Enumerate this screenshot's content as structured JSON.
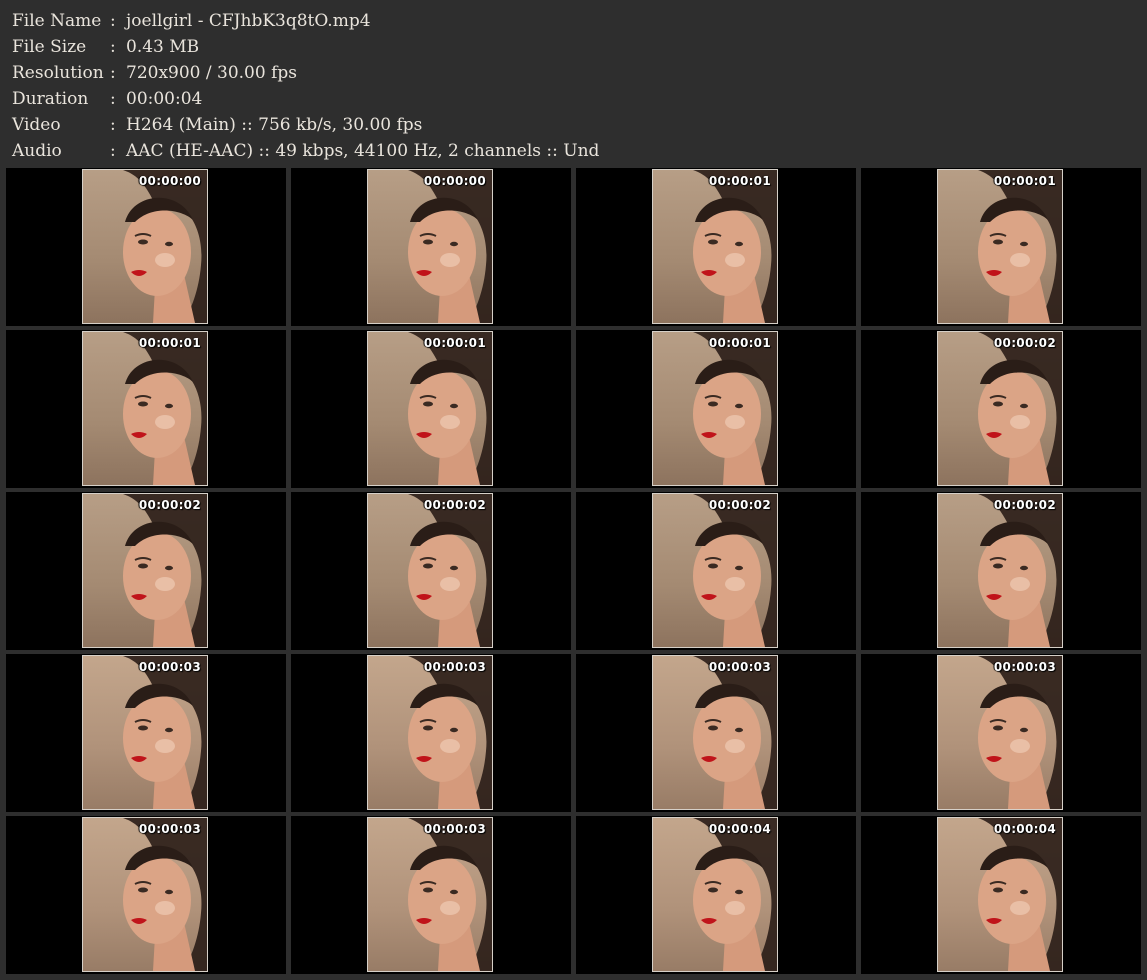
{
  "info": [
    {
      "key": "File Name",
      "sep": ":",
      "value": "joellgirl - CFJhbK3q8tO.mp4"
    },
    {
      "key": "File Size",
      "sep": ":",
      "value": "0.43 MB"
    },
    {
      "key": "Resolution",
      "sep": ":",
      "value": "720x900 / 30.00 fps"
    },
    {
      "key": "Duration",
      "sep": ":",
      "value": "00:00:04"
    },
    {
      "key": "Video",
      "sep": ":",
      "value": "H264 (Main) :: 756 kb/s, 30.00 fps"
    },
    {
      "key": "Audio",
      "sep": ":",
      "value": "AAC (HE-AAC) :: 49 kbps, 44100 Hz, 2 channels :: Und"
    }
  ],
  "thumbnails": [
    {
      "timestamp": "00:00:00"
    },
    {
      "timestamp": "00:00:00"
    },
    {
      "timestamp": "00:00:01"
    },
    {
      "timestamp": "00:00:01"
    },
    {
      "timestamp": "00:00:01"
    },
    {
      "timestamp": "00:00:01"
    },
    {
      "timestamp": "00:00:01"
    },
    {
      "timestamp": "00:00:02"
    },
    {
      "timestamp": "00:00:02"
    },
    {
      "timestamp": "00:00:02"
    },
    {
      "timestamp": "00:00:02"
    },
    {
      "timestamp": "00:00:02"
    },
    {
      "timestamp": "00:00:03"
    },
    {
      "timestamp": "00:00:03"
    },
    {
      "timestamp": "00:00:03"
    },
    {
      "timestamp": "00:00:03"
    },
    {
      "timestamp": "00:00:03"
    },
    {
      "timestamp": "00:00:03"
    },
    {
      "timestamp": "00:00:04"
    },
    {
      "timestamp": "00:00:04"
    }
  ]
}
